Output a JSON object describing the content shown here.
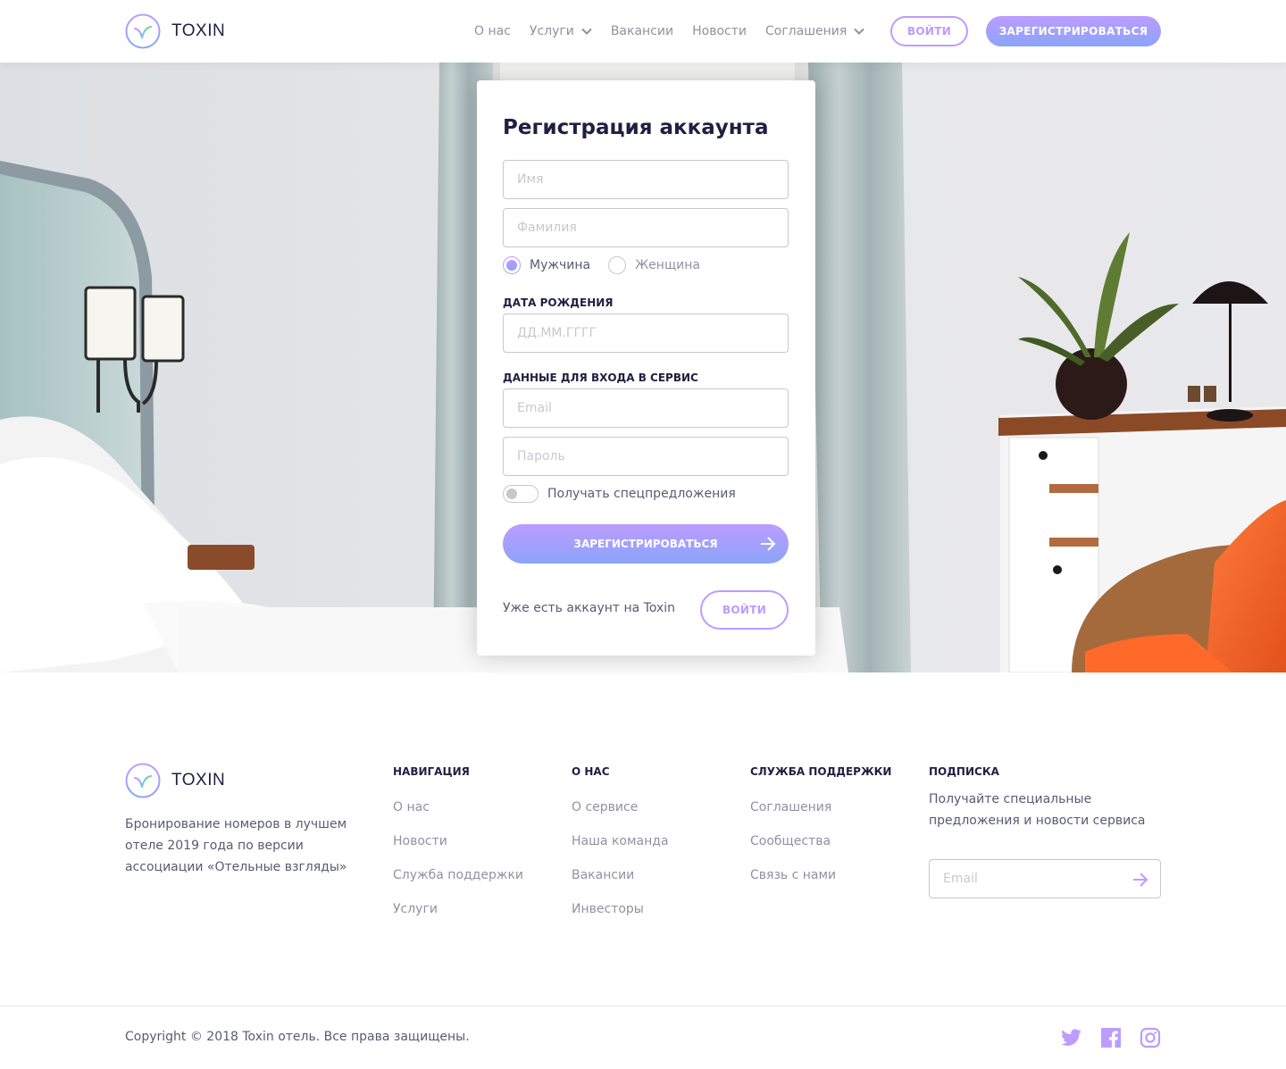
{
  "header": {
    "brand": "TOXIN",
    "nav": [
      {
        "label": "О нас",
        "dropdown": false
      },
      {
        "label": "Услуги",
        "dropdown": true
      },
      {
        "label": "Вакансии",
        "dropdown": false
      },
      {
        "label": "Новости",
        "dropdown": false
      },
      {
        "label": "Соглашения",
        "dropdown": true
      }
    ],
    "login_label": "ВОЙТИ",
    "register_label": "ЗАРЕГИСТРИРОВАТЬСЯ"
  },
  "form": {
    "title": "Регистрация аккаунта",
    "first_name_placeholder": "Имя",
    "last_name_placeholder": "Фамилия",
    "gender": {
      "options": [
        "Мужчина",
        "Женщина"
      ],
      "selected": "Мужчина"
    },
    "birthdate_label": "ДАТА РОЖДЕНИЯ",
    "birthdate_placeholder": "ДД.ММ.ГГГГ",
    "credentials_label": "ДАННЫЕ ДЛЯ ВХОДА В СЕРВИС",
    "email_placeholder": "Email",
    "password_placeholder": "Пароль",
    "offers_toggle_label": "Получать спецпредложения",
    "offers_toggle_on": false,
    "submit_label": "ЗАРЕГИСТРИРОВАТЬСЯ",
    "has_account_text": "Уже есть аккаунт на Toxin",
    "login_label": "ВОЙТИ"
  },
  "footer": {
    "brand": "TOXIN",
    "description": "Бронирование номеров в лучшем отеле 2019 года по версии ассоциации «Отельные взгляды»",
    "columns": [
      {
        "title": "НАВИГАЦИЯ",
        "links": [
          "О нас",
          "Новости",
          "Служба поддержки",
          "Услуги"
        ]
      },
      {
        "title": "О НАС",
        "links": [
          "О сервисе",
          "Наша команда",
          "Вакансии",
          "Инвесторы"
        ]
      },
      {
        "title": "СЛУЖБА ПОДДЕРЖКИ",
        "links": [
          "Соглашения",
          "Сообщества",
          "Связь с нами"
        ]
      }
    ],
    "subscribe": {
      "title": "ПОДПИСКА",
      "text": "Получайте специальные предложения и новости сервиса",
      "email_placeholder": "Email"
    },
    "copyright": "Copyright © 2018 Toxin отель. Все права защищены.",
    "social_icons": [
      "twitter-icon",
      "facebook-icon",
      "instagram-icon"
    ]
  },
  "colors": {
    "accent": "#BC9CFF",
    "accent_secondary": "#8BA4F9",
    "text_dark": "#1F2041"
  }
}
